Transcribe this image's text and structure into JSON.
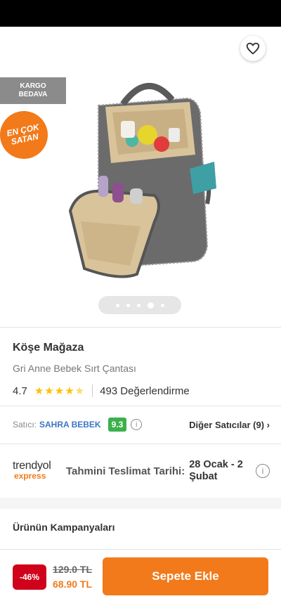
{
  "header": {
    "back_icon": "arrow-left-icon",
    "share_icon": "share-icon",
    "favorite_icon": "heart-outline-icon"
  },
  "badges": {
    "kargo_line1": "KARGO",
    "kargo_line2": "BEDAVA",
    "encok_line1": "EN ÇOK",
    "encok_line2": "SATAN"
  },
  "gallery": {
    "image_count": 5,
    "active_index": 3
  },
  "product": {
    "store": "Köşe Mağaza",
    "name": "Gri Anne Bebek Sırt Çantası",
    "rating": "4.7",
    "stars_value": 4.7,
    "review_count": "493 Değerlendirme"
  },
  "seller": {
    "label": "Satıcı:",
    "name": "SAHRA BEBEK",
    "score": "9.3",
    "other_sellers": "Diğer Satıcılar (9)"
  },
  "delivery": {
    "logo_top": "trendyol",
    "logo_bottom": "express",
    "label": "Tahmini Teslimat Tarihi:",
    "date": "28 Ocak - 2 Şubat"
  },
  "campaigns": {
    "title": "Ürünün Kampanyaları"
  },
  "bottom": {
    "discount": "-46%",
    "old_price": "129.0 TL",
    "new_price": "68.90 TL",
    "cart_button": "Sepete Ekle"
  },
  "colors": {
    "brand_orange": "#f27a1a",
    "discount_red": "#d0021b",
    "score_green": "#3cb04c",
    "seller_blue": "#3b77c5",
    "star_yellow": "#ffc000"
  }
}
